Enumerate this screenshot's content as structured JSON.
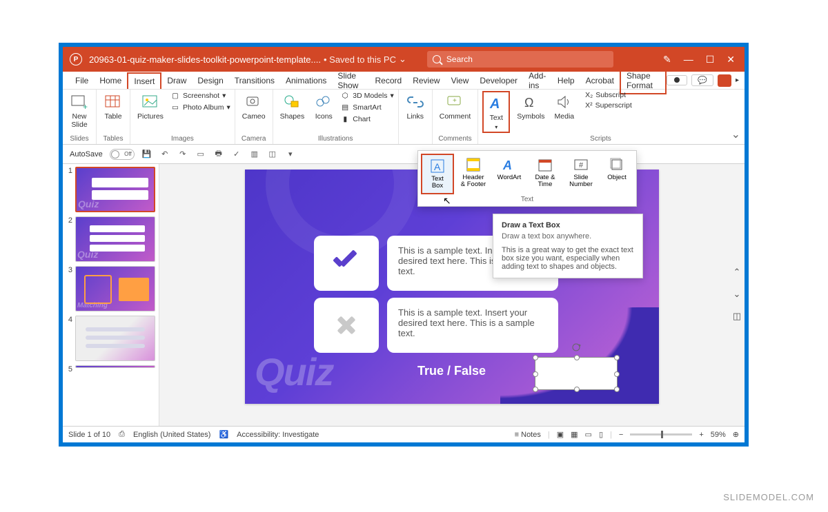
{
  "titlebar": {
    "app_icon": "P",
    "docname": "20963-01-quiz-maker-slides-toolkit-powerpoint-template....",
    "saved_label": "• Saved to this PC",
    "search_placeholder": "Search"
  },
  "tabs": {
    "file": "File",
    "home": "Home",
    "insert": "Insert",
    "draw": "Draw",
    "design": "Design",
    "transitions": "Transitions",
    "animations": "Animations",
    "slideshow": "Slide Show",
    "record": "Record",
    "review": "Review",
    "view": "View",
    "developer": "Developer",
    "addins": "Add-ins",
    "help": "Help",
    "acrobat": "Acrobat",
    "shape_format": "Shape Format"
  },
  "ribbon": {
    "new_slide": "New\nSlide",
    "slides_label": "Slides",
    "table": "Table",
    "tables_label": "Tables",
    "pictures": "Pictures",
    "screenshot": "Screenshot",
    "photo_album": "Photo Album",
    "images_label": "Images",
    "cameo": "Cameo",
    "camera_label": "Camera",
    "shapes": "Shapes",
    "icons": "Icons",
    "models3d": "3D Models",
    "smartart": "SmartArt",
    "chart": "Chart",
    "illus_label": "Illustrations",
    "links": "Links",
    "comment": "Comment",
    "comments_label": "Comments",
    "text": "Text",
    "symbols": "Symbols",
    "media": "Media",
    "subscript": "Subscript",
    "superscript": "Superscript",
    "scripts_label": "Scripts"
  },
  "text_dropdown": {
    "text_box": "Text\nBox",
    "header_footer": "Header\n& Footer",
    "wordart": "WordArt",
    "date_time": "Date &\nTime",
    "slide_number": "Slide\nNumber",
    "object": "Object",
    "group_label": "Text"
  },
  "tooltip": {
    "title": "Draw a Text Box",
    "subtitle": "Draw a text box anywhere.",
    "body": "This is a great way to get the exact text box size you want, especially when adding text to shapes and objects."
  },
  "qat": {
    "autosave": "AutoSave",
    "off": "Off"
  },
  "slide": {
    "quiz": "Quiz",
    "answer1": "This is a sample text. Insert your desired text here. This is a sample text.",
    "answer2": "This is a sample text. Insert your desired text here. This is a sample text.",
    "tf_label": "True / False"
  },
  "status": {
    "slide_of": "Slide 1 of 10",
    "lang": "English (United States)",
    "access": "Accessibility: Investigate",
    "notes": "Notes",
    "zoom": "59%"
  },
  "watermark": "SLIDEMODEL.COM"
}
